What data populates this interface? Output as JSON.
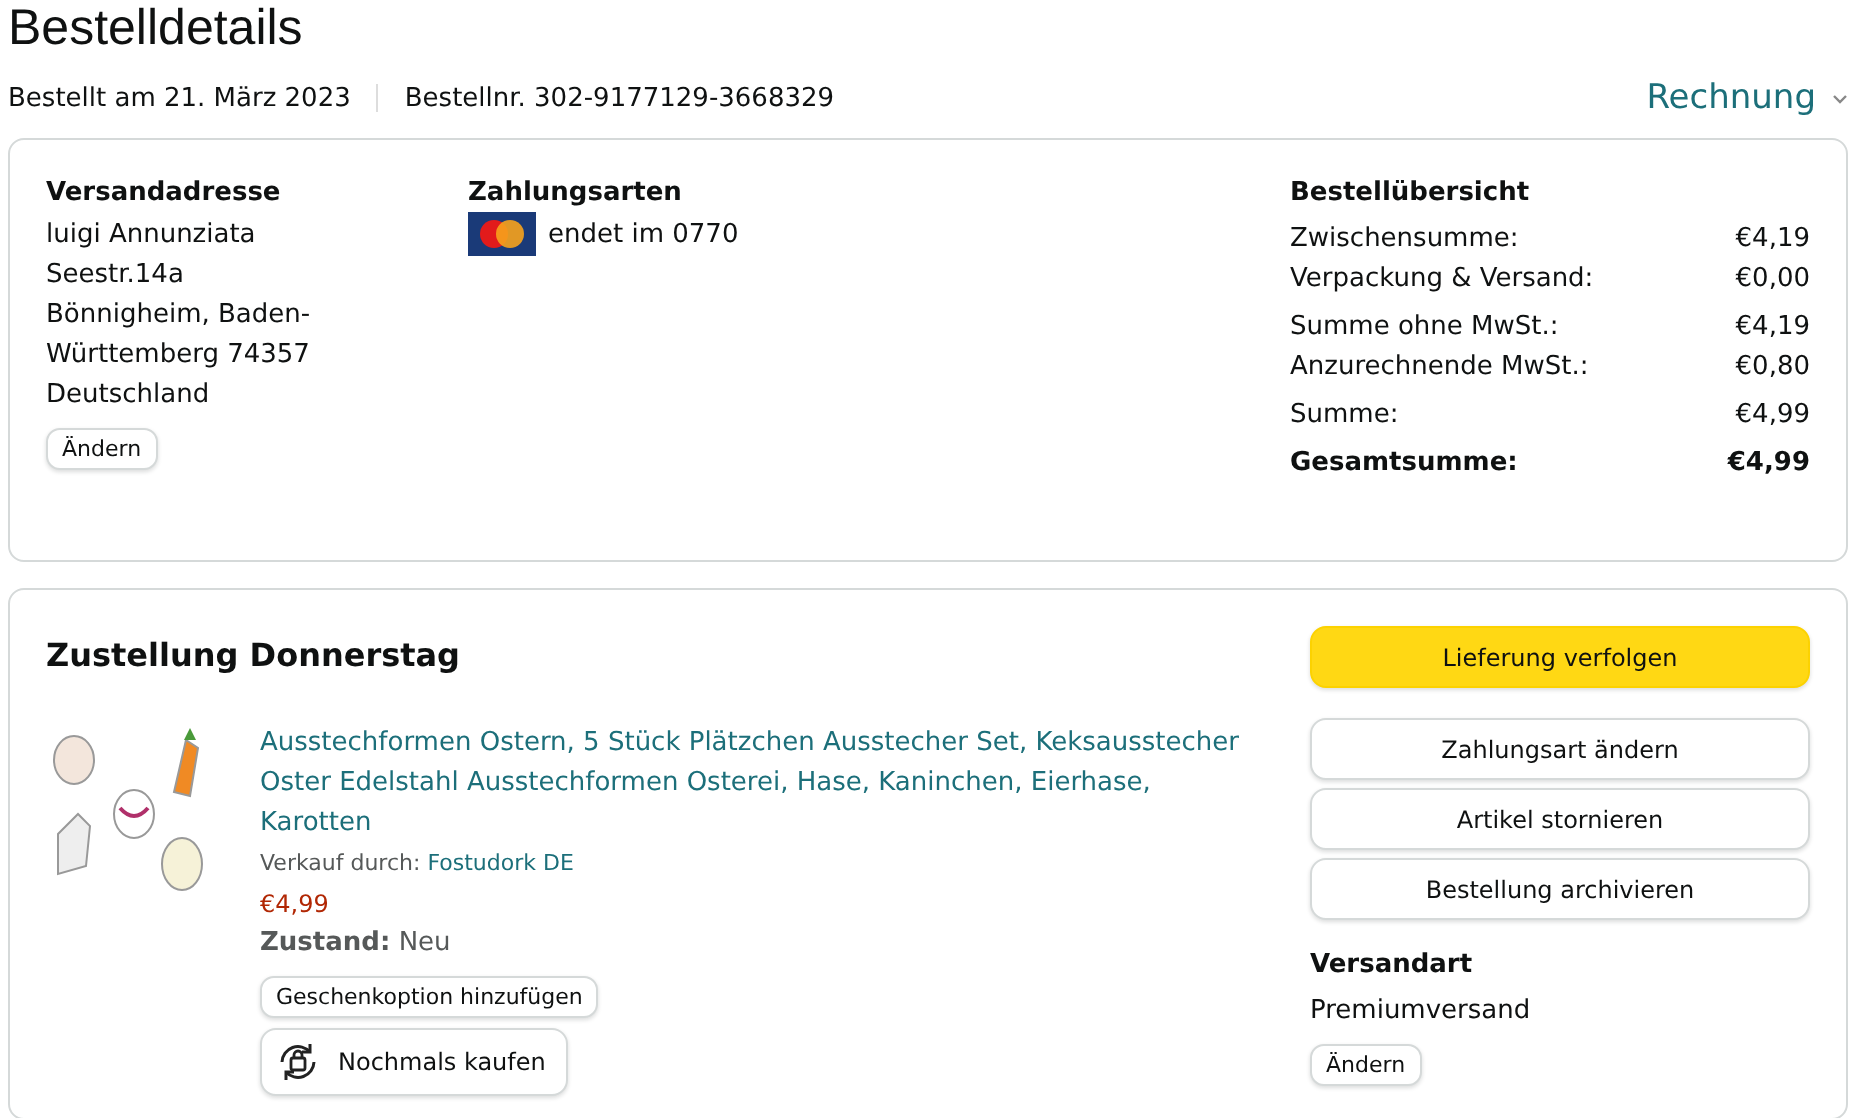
{
  "page": {
    "title": "Bestelldetails",
    "ordered": "Bestellt am 21. März 2023",
    "order_number": "Bestellnr. 302-9177129-3668329",
    "invoice_link": "Rechnung"
  },
  "shipping_address": {
    "heading": "Versandadresse",
    "lines": [
      "luigi Annunziata",
      "Seestr.14a",
      "Bönnigheim, Baden-",
      "Württemberg 74357",
      "Deutschland"
    ],
    "button": "Ändern"
  },
  "payment": {
    "heading": "Zahlungsarten",
    "card_text": "endet im 0770"
  },
  "summary": {
    "heading": "Bestellübersicht",
    "rows": [
      {
        "label": "Zwischensumme:",
        "value": "€4,19",
        "kind": "normal"
      },
      {
        "label": "Verpackung & Versand:",
        "value": "€0,00",
        "kind": "normal"
      },
      {
        "label": "Summe ohne MwSt.:",
        "value": "€4,19",
        "kind": "normal"
      },
      {
        "label": "Anzurechnende MwSt.:",
        "value": "€0,80",
        "kind": "normal"
      },
      {
        "label": "Summe:",
        "value": "€4,99",
        "kind": "normal"
      },
      {
        "label": "Gesamtsumme:",
        "value": "€4,99",
        "kind": "total"
      }
    ]
  },
  "shipment": {
    "heading": "Zustellung Donnerstag",
    "item": {
      "title": "Ausstechformen Ostern, 5 Stück Plätzchen Ausstecher Set, Keksausstecher Oster Edelstahl Ausstechformen Osterei, Hase, Kaninchen, Eierhase, Karotten",
      "seller_label": "Verkauf durch:",
      "seller": "Fostudork DE",
      "price": "€4,99",
      "condition_label": "Zustand:",
      "condition": "Neu",
      "gift_button": "Geschenkoption hinzufügen",
      "buy_again_button": "Nochmals kaufen"
    },
    "actions": [
      {
        "label": "Lieferung verfolgen",
        "kind": "primary"
      },
      {
        "label": "Zahlungsart ändern",
        "kind": "secondary"
      },
      {
        "label": "Artikel stornieren",
        "kind": "secondary"
      },
      {
        "label": "Bestellung archivieren",
        "kind": "secondary"
      }
    ],
    "shipping_method": {
      "heading": "Versandart",
      "value": "Premiumversand",
      "button": "Ändern"
    }
  }
}
